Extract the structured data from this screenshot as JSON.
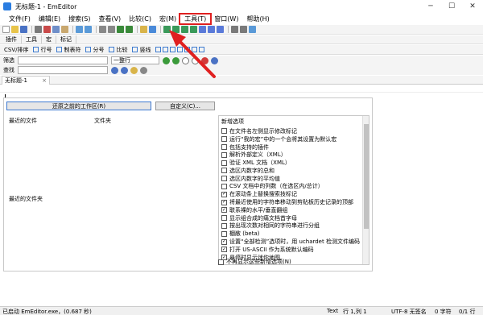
{
  "window": {
    "title": "无标题-1 - EmEditor",
    "controls": [
      "─",
      "☐",
      "✕"
    ]
  },
  "menu": [
    "文件(F)",
    "编辑(E)",
    "搜索(S)",
    "查看(V)",
    "比较(C)",
    "宏(M)",
    "工具(T)",
    "窗口(W)",
    "帮助(H)"
  ],
  "menu_highlight_index": 6,
  "toolbar_tabs": [
    "插件",
    "工具",
    "宏",
    "标记"
  ],
  "csv_bar": [
    "CSV/排序",
    "行号",
    "制表符",
    "分号",
    "比较",
    "竖线"
  ],
  "filter_bar": {
    "label": "筛选",
    "combo": "一整行"
  },
  "find_bar": {
    "label": "查找"
  },
  "document_tab": {
    "label": "无标题-1",
    "close": "×"
  },
  "startup_panel": {
    "restore_button": "还原之前的工作区(R)",
    "customize_button": "自定义(C)...",
    "recent_files_header": "最近的文件",
    "folder_header": "文件夹",
    "recent_folders_header": "最近的文件夹",
    "options_header": "新增选项",
    "options": [
      {
        "label": "在文件名左侧显示修改标记",
        "checked": false
      },
      {
        "label": "运行“我的宏”中的一个会将其设置为默认宏",
        "checked": false
      },
      {
        "label": "包括支持的插件",
        "checked": false
      },
      {
        "label": "解析外部定义（XML）",
        "checked": false
      },
      {
        "label": "验证 XML 文档（XML）",
        "checked": false
      },
      {
        "label": "选区内数字的总和",
        "checked": false
      },
      {
        "label": "选区内数字的平均值",
        "checked": false
      },
      {
        "label": "CSV 文档中的列数（在选区内/总计）",
        "checked": false
      },
      {
        "label": "在滚动条上替换搜索技标记",
        "checked": true
      },
      {
        "label": "将最近使用的字符串移动到剪贴板历史记录的顶部",
        "checked": true
      },
      {
        "label": "联系裸的水平/垂直翻组",
        "checked": true
      },
      {
        "label": "显示组合成的痛文档首字母",
        "checked": false
      },
      {
        "label": "按出现次数对相同的字符串进行分组",
        "checked": false
      },
      {
        "label": "棚敝 (beta)",
        "checked": false
      },
      {
        "label": "设置“全部检测”选项时，用 uchardet 检测文件编码",
        "checked": true
      },
      {
        "label": "打开 US-ASCII 作为系统默认编码",
        "checked": true
      },
      {
        "label": "悬停时显示迷你地图",
        "checked": true
      }
    ],
    "dont_show": "不再显示这些新增选项(N)"
  },
  "status_bar": {
    "left": "已启动 EmEditor.exe，(0.687 秒)",
    "type": "Text",
    "position": "行 1,列 1",
    "encoding": "UTF-8 无签名",
    "chars": "0 字符",
    "lines": "0/1 行"
  },
  "colors": {
    "highlight_box": "#e02020",
    "arrow": "#e02020",
    "accent": "#3c78d0"
  }
}
